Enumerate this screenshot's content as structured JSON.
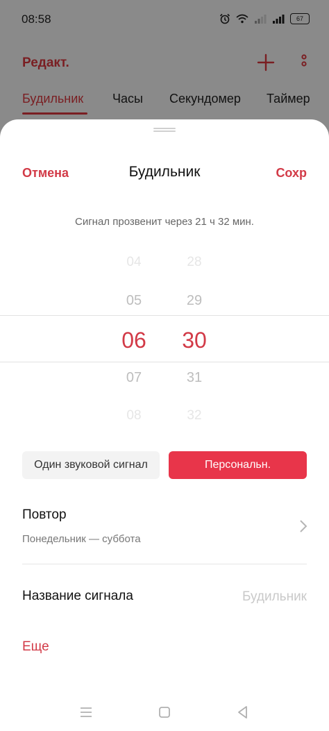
{
  "status": {
    "time": "08:58",
    "battery": "67"
  },
  "background": {
    "edit_label": "Редакт.",
    "tabs": [
      {
        "label": "Будильник",
        "active": true
      },
      {
        "label": "Часы",
        "active": false
      },
      {
        "label": "Секундомер",
        "active": false
      },
      {
        "label": "Таймер",
        "active": false
      }
    ]
  },
  "sheet": {
    "cancel_label": "Отмена",
    "title": "Будильник",
    "save_label": "Сохр",
    "ring_info": "Сигнал прозвенит через 21 ч 32 мин."
  },
  "picker": {
    "hours": [
      "04",
      "05",
      "06",
      "07",
      "08"
    ],
    "minutes": [
      "28",
      "29",
      "30",
      "31",
      "32"
    ],
    "selected_hour": "06",
    "selected_minute": "30"
  },
  "options": {
    "single_sound": "Один звуковой сигнал",
    "personal": "Персональн."
  },
  "repeat": {
    "title": "Повтор",
    "value": "Понедельник — суббота"
  },
  "alarm_name": {
    "label": "Название сигнала",
    "value": "Будильник"
  },
  "more_label": "Еще",
  "colors": {
    "accent": "#e8354a",
    "accent_text": "#d23a47",
    "dim_background": "#8a8a8a"
  }
}
